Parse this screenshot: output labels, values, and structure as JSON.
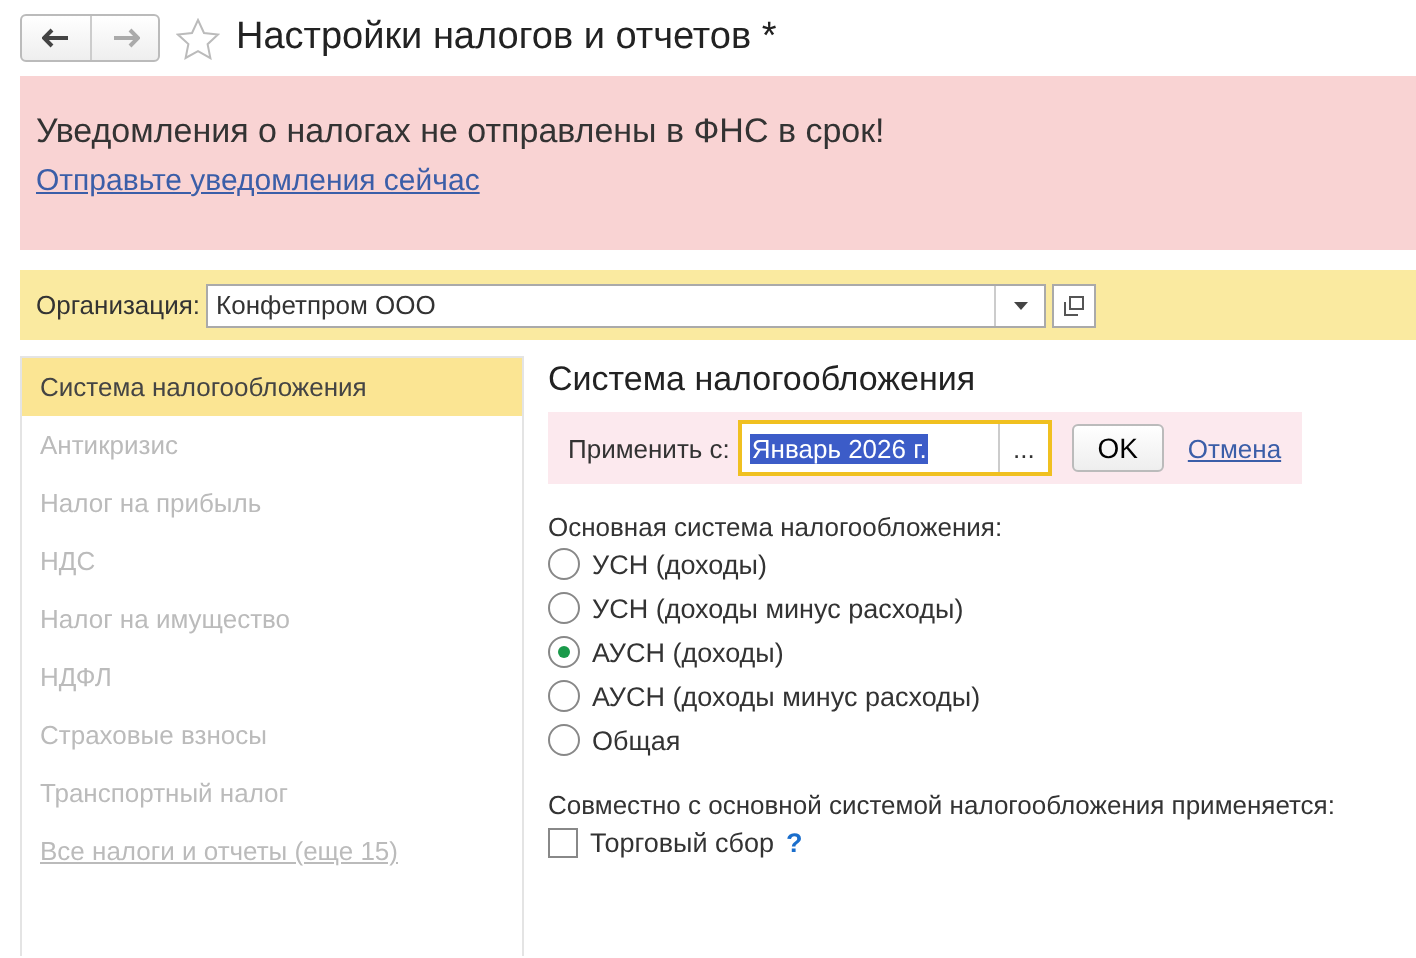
{
  "window": {
    "title": "Настройки налогов и отчетов *",
    "favorite": false
  },
  "alert": {
    "message": "Уведомления о налогах не отправлены в ФНС в срок!",
    "link": "Отправьте уведомления сейчас"
  },
  "organization": {
    "label": "Организация:",
    "value": "Конфетпром ООО"
  },
  "sidebar": {
    "items": [
      {
        "label": "Система налогообложения",
        "kind": "item",
        "selected": true,
        "disabled": false
      },
      {
        "label": "Антикризис",
        "kind": "item",
        "selected": false,
        "disabled": true
      },
      {
        "label": "Налог на прибыль",
        "kind": "item",
        "selected": false,
        "disabled": true
      },
      {
        "label": "НДС",
        "kind": "item",
        "selected": false,
        "disabled": true
      },
      {
        "label": "Налог на имущество",
        "kind": "item",
        "selected": false,
        "disabled": true
      },
      {
        "label": "НДФЛ",
        "kind": "item",
        "selected": false,
        "disabled": true
      },
      {
        "label": "Страховые взносы",
        "kind": "item",
        "selected": false,
        "disabled": true
      },
      {
        "label": "Транспортный налог",
        "kind": "item",
        "selected": false,
        "disabled": true
      },
      {
        "label": "Все налоги и отчеты (еще 15)",
        "kind": "link",
        "selected": false,
        "disabled": true
      }
    ]
  },
  "section": {
    "title": "Система налогообложения",
    "apply": {
      "label": "Применить с:",
      "value": "Январь 2026 г.",
      "choose": "...",
      "ok": "OK",
      "cancel": "Отмена"
    },
    "main_label": "Основная система налогообложения:",
    "options": [
      {
        "label": "УСН (доходы)",
        "selected": false
      },
      {
        "label": "УСН (доходы минус расходы)",
        "selected": false
      },
      {
        "label": "АУСН (доходы)",
        "selected": true
      },
      {
        "label": "АУСН (доходы минус расходы)",
        "selected": false
      },
      {
        "label": "Общая",
        "selected": false
      }
    ],
    "extra_label": "Совместно с основной системой налогообложения применяется:",
    "extras": [
      {
        "label": "Торговый сбор",
        "checked": false,
        "help": "?"
      }
    ]
  }
}
